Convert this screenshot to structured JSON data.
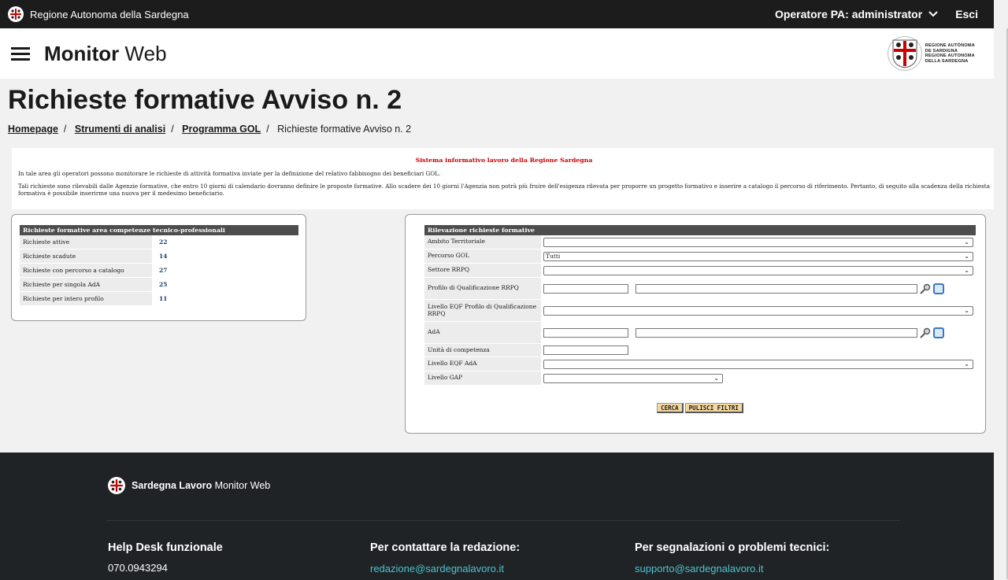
{
  "topbar": {
    "region": "Regione Autonoma della Sardegna",
    "user_label": "Operatore PA: administrator",
    "exit_label": "Esci"
  },
  "header": {
    "brand_bold": "Monitor",
    "brand_rest": " Web",
    "logo_lines": [
      "REGIONE AUTÒNOMA",
      "DE SARDIGNA",
      "REGIONE AUTONOMA",
      "DELLA SARDEGNA"
    ]
  },
  "page": {
    "title": "Richieste formative Avviso n. 2",
    "breadcrumb": [
      "Homepage",
      "Strumenti di analisi",
      "Programma GOL",
      "Richieste formative Avviso n. 2"
    ]
  },
  "info": {
    "system_title": "Sistema informativo lavoro della Regione Sardegna",
    "p1": "In tale area gli operatori possono monitorare le richieste di attività formativa inviate per la definizione del relativo fabbisogno dei beneficiari GOL.",
    "p2": "Tali richieste sono rilevabili dalle Agenzie formative, che entro 10 giorni di calendario dovranno definire le proposte formative. Allo scadere dei 10 giorni l'Agenzia non potrà più fruire dell'esigenza rilevata per proporre un progetto formativo e inserire a catalogo il percorso di riferimento. Pertanto, di seguito alla scadenza della richiesta formativa è possibile inserirme una nuova per il medesimo beneficiario."
  },
  "stats": {
    "title": "Richieste formative area competenze tecnico-professionali",
    "rows": [
      {
        "label": "Richieste attive",
        "value": "22"
      },
      {
        "label": "Richieste scadute",
        "value": "14"
      },
      {
        "label": "Richieste con percorso a catalogo",
        "value": "27"
      },
      {
        "label": "Richieste per singola AdA",
        "value": "25"
      },
      {
        "label": "Richieste per intero profilo",
        "value": "11"
      }
    ]
  },
  "search": {
    "title": "Rilevazione richieste formative",
    "ambito_label": "Ambito Territoriale",
    "ambito_value": "",
    "percorso_label": "Percorso GOL",
    "percorso_value": "Tutti",
    "settore_label": "Settore RRPQ",
    "settore_value": "",
    "profilo_label": "Profilo di Qualificazione RRPQ",
    "livello_eqf_profilo_label": "Livello EQF Profilo di Qualificazione RRPQ",
    "livello_eqf_profilo_value": "",
    "ada_label": "AdA",
    "unita_label": "Unità di competenza",
    "livello_eqf_ada_label": "Livello EQF AdA",
    "livello_eqf_ada_value": "",
    "livello_gap_label": "Livello GAP",
    "livello_gap_value": "",
    "search_button": "CERCA",
    "clear_button": "PULISCI FILTRI"
  },
  "footer": {
    "brand_bold": "Sardegna Lavoro",
    "brand_rest": " Monitor Web",
    "helpdesk_title": "Help Desk funzionale",
    "helpdesk_phone": "070.0943294",
    "redazione_title": "Per contattare la redazione:",
    "redazione_email": "redazione@sardegnalavoro.it",
    "supporto_title": "Per segnalazioni o problemi tecnici:",
    "supporto_email": "supporto@sardegnalavoro.it"
  },
  "icons": {
    "crest": "sardinia-crest-icon",
    "menu": "hamburger-menu-icon",
    "chevron": "chevron-down-icon",
    "search": "search-icon",
    "lookup": "box-icon"
  },
  "colors": {
    "topbar": "#1c1c1c",
    "footer": "#1f2326",
    "link": "#4dc4cf",
    "system_title": "#d00000",
    "button": "#f2d8a0"
  }
}
